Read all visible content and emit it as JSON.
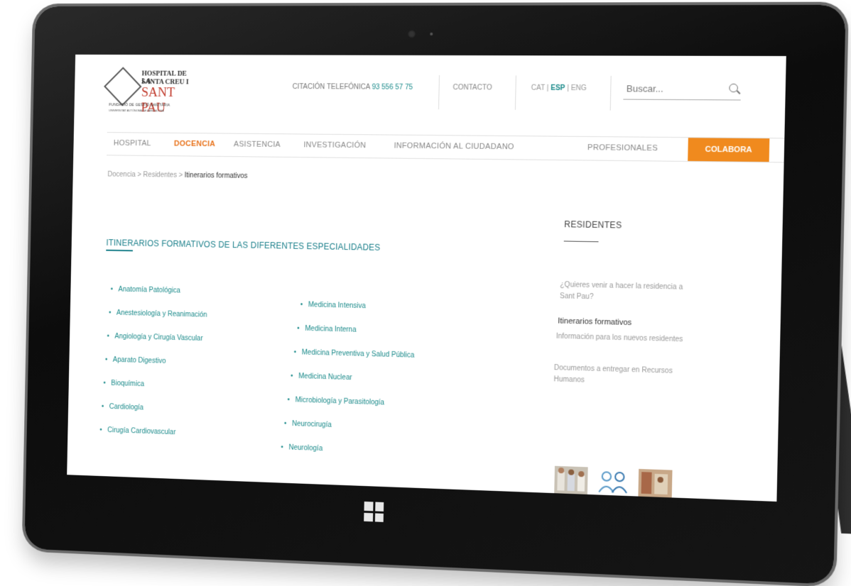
{
  "header": {
    "logo": {
      "line1": "HOSPITAL DE LA",
      "line2": "SANTA CREU I",
      "line3": "SANT PAU",
      "line4": "FUNDACIÓ DE GESTIÓ SANITÀRIA",
      "line5": "UNIVERSITAT AUTÒNOMA DE BARCELONA"
    },
    "citacion_label": "CITACIÓN TELEFÓNICA",
    "citacion_phone": "93 556 57 75",
    "contacto": "CONTACTO",
    "languages": [
      "CAT",
      "ESP",
      "ENG"
    ],
    "active_language": "ESP",
    "search_placeholder": "Buscar..."
  },
  "nav": {
    "items": [
      "HOSPITAL",
      "DOCENCIA",
      "ASISTENCIA",
      "INVESTIGACIÓN",
      "INFORMACIÓN AL CIUDADANO",
      "PROFESIONALES"
    ],
    "active": "DOCENCIA",
    "cta": "COLABORA",
    "accent_color": "#e8731c",
    "cta_color": "#f08a1e"
  },
  "breadcrumb": {
    "items": [
      "Docencia",
      "Residentes"
    ],
    "current": "Itinerarios formativos"
  },
  "main": {
    "title": "ITINERARIOS FORMATIVOS DE LAS DIFERENTES ESPECIALIDADES",
    "col1": [
      "Anatomía Patológica",
      "Anestesiología y Reanimación",
      "Angiología y Cirugía Vascular",
      "Aparato Digestivo",
      "Bioquímica",
      "Cardiología",
      "Cirugía Cardiovascular"
    ],
    "col2": [
      "Medicina Intensiva",
      "Medicina Interna",
      "Medicina Preventiva y Salud Pública",
      "Medicina Nuclear",
      "Microbiología y Parasitología",
      "Neurocirugía",
      "Neurología"
    ],
    "link_color": "#1a8a8a"
  },
  "sidebar": {
    "title": "RESIDENTES",
    "links": [
      "¿Quieres venir a hacer la residencia a Sant Pau?",
      "Itinerarios formativos",
      "Información para los nuevos residentes",
      "Documentos a entregar en Recursos Humanos"
    ],
    "current": "Itinerarios formativos"
  }
}
